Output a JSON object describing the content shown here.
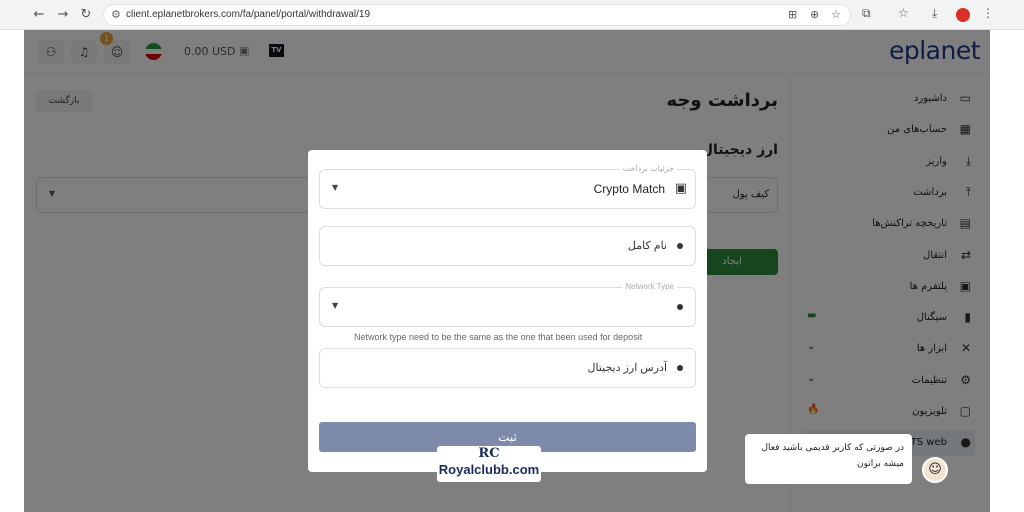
{
  "browser": {
    "back": "←",
    "forward": "→",
    "reload": "↻",
    "site_icon": "⚙",
    "url": "client.eplanetbrokers.com/fa/panel/portal/withdrawal/19",
    "icons": [
      "translate-icon",
      "zoom-icon",
      "bookmark-star-icon",
      "extensions-icon",
      "bookmarks-icon",
      "download-icon",
      "profile-icon",
      "menu-icon"
    ]
  },
  "topbar": {
    "balance": "0.00 USD",
    "notification_count": "1",
    "logo": "eplanet",
    "tv_label": "TV"
  },
  "sidebar": {
    "items": [
      {
        "label": "داشبورد",
        "icon": "▭"
      },
      {
        "label": "حساب‌های من",
        "icon": "▦"
      },
      {
        "label": "واریز",
        "icon": "⤓"
      },
      {
        "label": "برداشت",
        "icon": "⤒"
      },
      {
        "label": "تاریخچه تراکنش‌ها",
        "icon": "▤"
      },
      {
        "label": "انتقال",
        "icon": "⇄"
      },
      {
        "label": "پلتفرم ها",
        "icon": "▣"
      },
      {
        "label": "سیگنال",
        "icon": "▮",
        "extra": "▬"
      },
      {
        "label": "ابزار ها",
        "icon": "✕",
        "extra": "⌄"
      },
      {
        "label": "تنظیمات",
        "icon": "⚙",
        "extra": "⌄"
      },
      {
        "label": "تلویزیون",
        "icon": "▢",
        "extra": "🔥"
      },
      {
        "label": "MTS web",
        "icon": "●"
      }
    ]
  },
  "main": {
    "title": "برداشت وجه",
    "back_label": "بازگشت",
    "subtitle": "ارز دیجیتال",
    "wallet_label": "کیف پول",
    "create_label": "ایجاد"
  },
  "modal": {
    "payment_details_legend": "جزئیات برداخت",
    "payment_method": "Crypto Match",
    "full_name_placeholder": "نام کامل",
    "network_type_legend": "Network Type",
    "network_hint": "Network type need to be the same as the one that been used for deposit",
    "address_placeholder": "آدرس ارز دیجیتال",
    "submit_label": "ثبت"
  },
  "chat": {
    "message_line1": "در صورتی که کاربر قدیمی باشید فعال",
    "message_line2": "میشه براتون"
  },
  "watermark": {
    "monogram": "RC",
    "site": "Royalclubb.com"
  }
}
